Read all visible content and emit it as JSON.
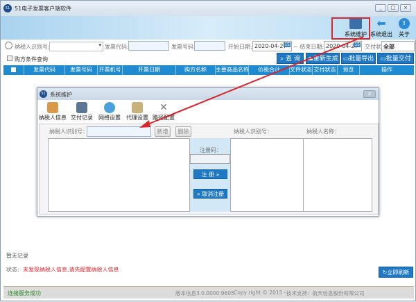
{
  "window": {
    "title": "51电子发票客户端软件",
    "controls": [
      "_",
      "□",
      "×"
    ]
  },
  "toolbar": {
    "items": [
      {
        "label": "系统维护",
        "icon": "system-maintenance-icon"
      },
      {
        "label": "系统退出",
        "icon": "exit-arrow-icon"
      },
      {
        "label": "关于",
        "icon": "about-info-icon"
      }
    ]
  },
  "filters": {
    "taxpayer_id_label": "纳税人识别号:",
    "taxpayer_id_value": "",
    "invoice_code_label": "发票代码:",
    "invoice_code_value": "",
    "invoice_number_label": "发票号码:",
    "invoice_number_value": "",
    "start_date_label": "开始日期:",
    "start_date": "2020-04-27",
    "end_date_label": "~ 结束日期:",
    "end_date": "2020-04-27",
    "calendar_badge": "15",
    "delivery_status_label": "交付状态:",
    "delivery_status": "全部",
    "buyer_query_label": "购方条件查询"
  },
  "actions": {
    "query": "查 询",
    "regenerate": "重新生成",
    "batch_export": "批量导出",
    "batch_deliver": "批量交付"
  },
  "table": {
    "columns": [
      "发票代码",
      "发票号码",
      "开票机号",
      "开票日期",
      "购方名称",
      "主要商品名称",
      "价税合计",
      "文件状态",
      "交付状态",
      "预览",
      "操作"
    ]
  },
  "dialog": {
    "title": "系统维护",
    "close": "×",
    "tabs": [
      "纳税人信息",
      "交付记录",
      "网络设置",
      "代理设置",
      "路径配置"
    ],
    "taxpayer_id_label": "纳税人识别号：",
    "taxpayer_id_value": "",
    "add_button": "新增",
    "delete_button": "删除",
    "reg_code_label": "注册码：",
    "reg_code_value": "",
    "register_button": "注 册 »",
    "unregister_button": "« 取消注册",
    "right_col1": "纳税人识别号：",
    "right_col2": "纳税人名称："
  },
  "main": {
    "no_records": "暂无记录",
    "status_label": "状态:",
    "status_message": "未发现纳税人信息,请先配置纳税人信息",
    "refresh_button": "立即刷新",
    "status_color": "#e8262b"
  },
  "footer": {
    "connection": "连接服务成功",
    "version": "版本信息3.0.0000.9605",
    "copyright": "Copy right © 2015 -",
    "support": "技术支持：航天信息股份有限公司"
  }
}
